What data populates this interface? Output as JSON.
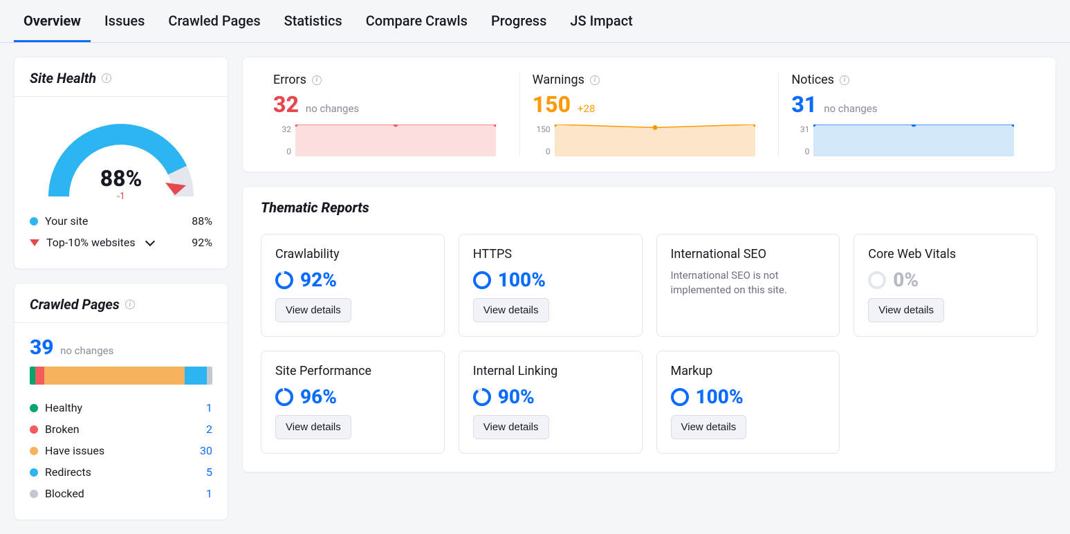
{
  "tabs": [
    "Overview",
    "Issues",
    "Crawled Pages",
    "Statistics",
    "Compare Crawls",
    "Progress",
    "JS Impact"
  ],
  "activeTab": 0,
  "siteHealth": {
    "title": "Site Health",
    "value": "88%",
    "delta": "-1",
    "legend": {
      "yourSite": {
        "label": "Your site",
        "value": "88%",
        "color": "#2db5f2"
      },
      "top10": {
        "label": "Top-10% websites",
        "value": "92%"
      }
    }
  },
  "crawledPages": {
    "title": "Crawled Pages",
    "total": "39",
    "note": "no changes",
    "segments": [
      {
        "label": "Healthy",
        "value": "1",
        "color": "#00a66e",
        "pct": 3
      },
      {
        "label": "Broken",
        "value": "2",
        "color": "#f25c5c",
        "pct": 5
      },
      {
        "label": "Have issues",
        "value": "30",
        "color": "#f6b25c",
        "pct": 77
      },
      {
        "label": "Redirects",
        "value": "5",
        "color": "#2db5f2",
        "pct": 12
      },
      {
        "label": "Blocked",
        "value": "1",
        "color": "#c3c7d0",
        "pct": 3
      }
    ]
  },
  "issues": {
    "errors": {
      "title": "Errors",
      "value": "32",
      "note": "no changes",
      "color": "#f25c5c",
      "fill": "#fcdede",
      "axisTop": "32",
      "axisBot": "0"
    },
    "warnings": {
      "title": "Warnings",
      "value": "150",
      "note": "+28",
      "color": "#fe9a00",
      "fill": "#fde5c9",
      "axisTop": "150",
      "axisBot": "0"
    },
    "notices": {
      "title": "Notices",
      "value": "31",
      "note": "no changes",
      "color": "#0a6cff",
      "fill": "#d2e8fb",
      "axisTop": "31",
      "axisBot": "0"
    }
  },
  "thematic": {
    "title": "Thematic Reports",
    "viewDetails": "View details",
    "tiles": [
      {
        "title": "Crawlability",
        "value": "92%",
        "pct": 92,
        "button": true
      },
      {
        "title": "HTTPS",
        "value": "100%",
        "pct": 100,
        "button": true
      },
      {
        "title": "International SEO",
        "sub": "International SEO is not implemented on this site."
      },
      {
        "title": "Core Web Vitals",
        "value": "0%",
        "pct": 0,
        "gray": true,
        "button": true
      },
      {
        "title": "Site Performance",
        "value": "96%",
        "pct": 96,
        "button": true
      },
      {
        "title": "Internal Linking",
        "value": "90%",
        "pct": 90,
        "button": true
      },
      {
        "title": "Markup",
        "value": "100%",
        "pct": 100,
        "button": true
      }
    ]
  },
  "chart_data": [
    {
      "type": "line",
      "title": "Errors",
      "x": [
        1,
        2,
        3
      ],
      "values": [
        32,
        32,
        32
      ],
      "ylim": [
        0,
        32
      ],
      "ylabel": "",
      "xlabel": ""
    },
    {
      "type": "line",
      "title": "Warnings",
      "x": [
        1,
        2,
        3
      ],
      "values": [
        150,
        135,
        150
      ],
      "ylim": [
        0,
        150
      ],
      "ylabel": "",
      "xlabel": ""
    },
    {
      "type": "line",
      "title": "Notices",
      "x": [
        1,
        2,
        3
      ],
      "values": [
        31,
        31,
        31
      ],
      "ylim": [
        0,
        31
      ],
      "ylabel": "",
      "xlabel": ""
    }
  ]
}
